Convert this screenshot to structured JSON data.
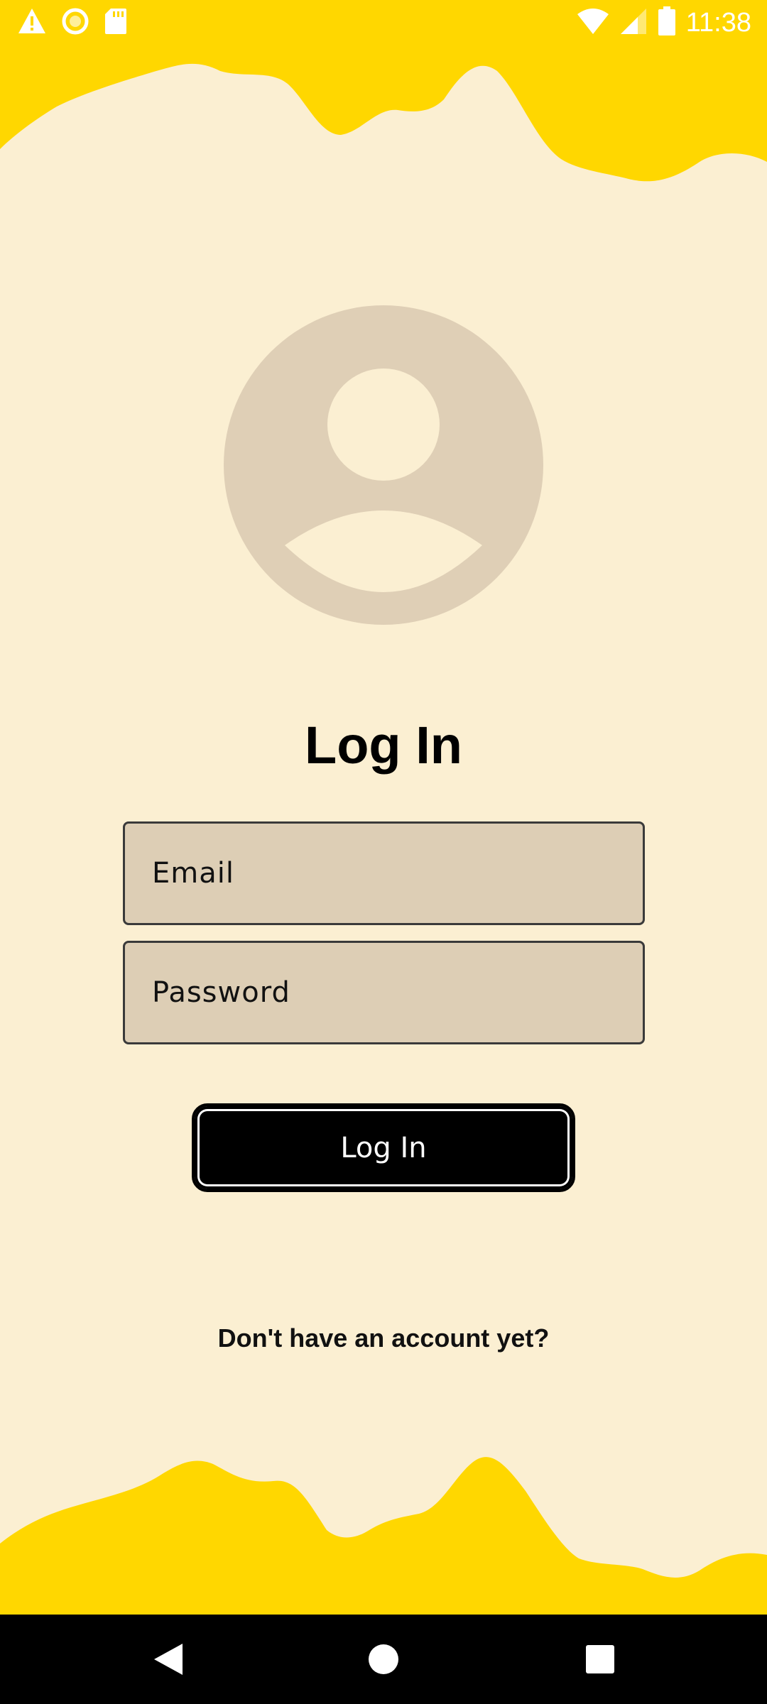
{
  "status_bar": {
    "time": "11:38",
    "icons_left": [
      "warning-icon",
      "record-icon",
      "sd-card-icon"
    ],
    "icons_right": [
      "wifi-icon",
      "cell-signal-icon",
      "battery-icon"
    ]
  },
  "login": {
    "title": "Log In",
    "email_placeholder": "Email",
    "password_placeholder": "Password",
    "submit_label": "Log In",
    "signup_prompt": "Don't have an account yet?"
  },
  "nav_bar": {
    "buttons": [
      "back-icon",
      "home-icon",
      "recents-icon"
    ]
  },
  "colors": {
    "background": "#FBEFD2",
    "wave": "#FFD700",
    "field_fill": "#DDCEB5",
    "avatar": "#DFCFB6",
    "button": "#000000"
  }
}
